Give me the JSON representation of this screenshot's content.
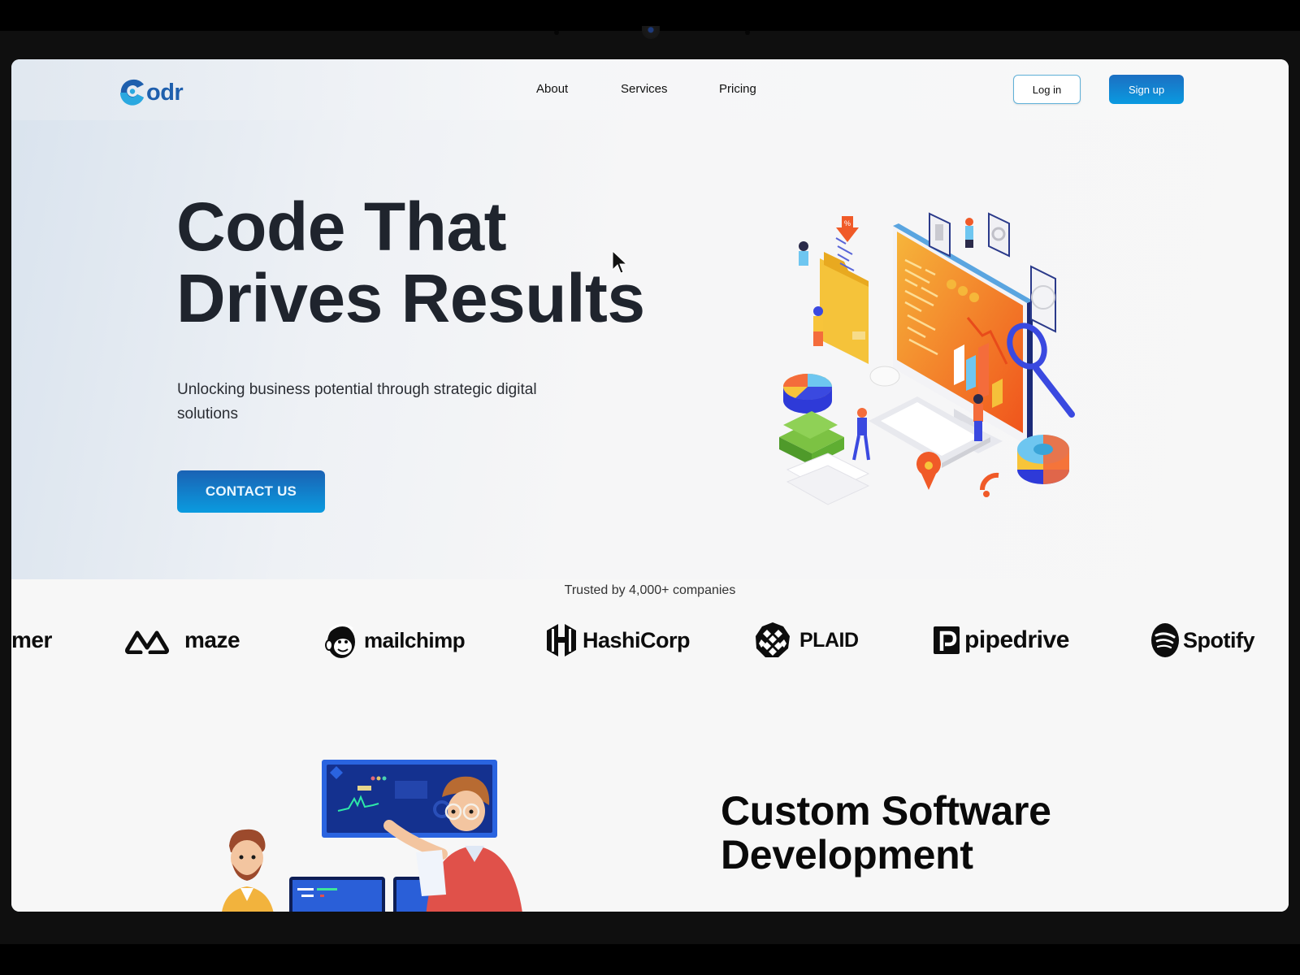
{
  "brand": {
    "name": "Codr",
    "logo_letter": "C",
    "logo_rest": "odr",
    "color_primary": "#1e5fad",
    "color_accent": "#2aa8e0"
  },
  "nav": {
    "links": [
      {
        "label": "About"
      },
      {
        "label": "Services"
      },
      {
        "label": "Pricing"
      }
    ],
    "login_label": "Log in",
    "signup_label": "Sign up"
  },
  "hero": {
    "title_line1": "Code That",
    "title_line2": "Drives Results",
    "subtitle": "Unlocking business potential through strategic digital solutions",
    "cta_label": "CONTACT US",
    "illustration": "isometric-computer-analytics-illustration"
  },
  "trusted": {
    "text": "Trusted by 4,000+ companies",
    "logos": [
      {
        "name": "mer",
        "icon": "partial-logo"
      },
      {
        "name": "maze",
        "icon": "maze-icon"
      },
      {
        "name": "mailchimp",
        "icon": "mailchimp-icon"
      },
      {
        "name": "HashiCorp",
        "icon": "hashicorp-icon"
      },
      {
        "name": "PLAID",
        "icon": "plaid-icon"
      },
      {
        "name": "pipedrive",
        "icon": "pipedrive-icon"
      },
      {
        "name": "Spotify",
        "icon": "spotify-icon"
      }
    ]
  },
  "section": {
    "title_line1": "Custom Software",
    "title_line2": "Development",
    "illustration": "developers-dashboard-illustration"
  }
}
